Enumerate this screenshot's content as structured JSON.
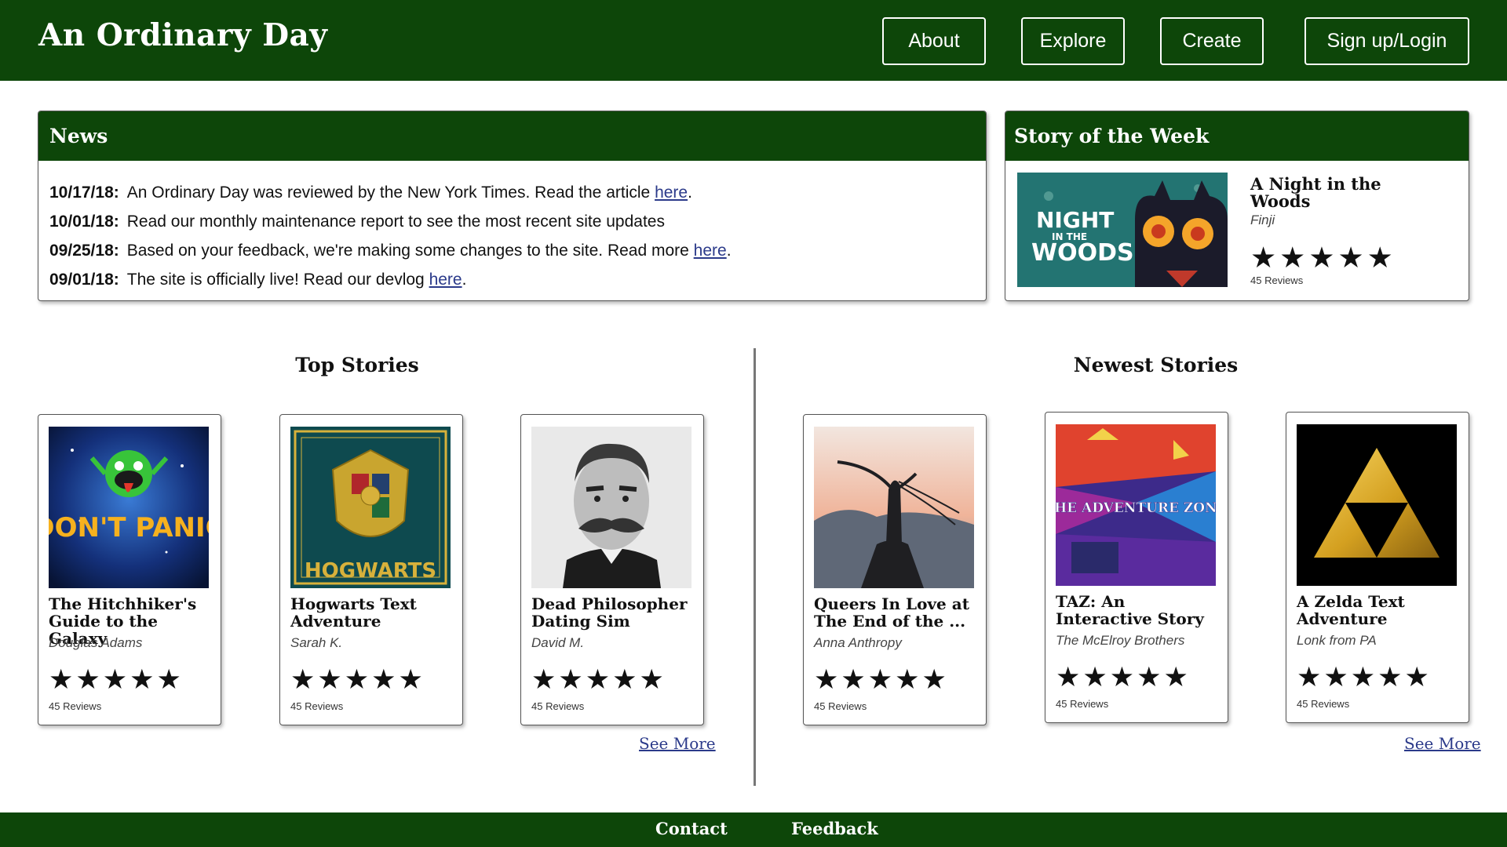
{
  "header": {
    "title": "An Ordinary Day",
    "nav": [
      "About",
      "Explore",
      "Create",
      "Sign up/Login"
    ]
  },
  "news": {
    "heading": "News",
    "items": [
      {
        "date": "10/17/18:",
        "text": "An Ordinary Day was reviewed by the New York Times. Read the article ",
        "link": "here",
        "after": "."
      },
      {
        "date": "10/01/18:",
        "text": "Read our monthly maintenance report to see the most recent site updates",
        "link": "",
        "after": ""
      },
      {
        "date": "09/25/18:",
        "text": "Based on your feedback, we're making some changes to the site. Read more ",
        "link": "here",
        "after": "."
      },
      {
        "date": "09/01/18:",
        "text": "The site is officially live! Read our devlog ",
        "link": "here",
        "after": "."
      }
    ]
  },
  "story_of_week": {
    "heading": "Story of the Week",
    "title": "A Night in the Woods",
    "author": "Finji",
    "rating": 5,
    "stars": "★★★★★",
    "reviews": "45 Reviews",
    "cover_text_1": "NIGHT",
    "cover_text_2": "IN THE",
    "cover_text_3": "WOODS"
  },
  "top_stories": {
    "heading": "Top Stories",
    "see_more": "See More",
    "items": [
      {
        "title": "The Hitchhiker's Guide to the Galaxy",
        "author": "Douglas Adams",
        "rating": 5,
        "stars": "★★★★★",
        "reviews": "45 Reviews",
        "cover_text": "DON'T PANIC"
      },
      {
        "title": "Hogwarts Text Adventure",
        "author": "Sarah K.",
        "rating": 5,
        "stars": "★★★★★",
        "reviews": "45 Reviews",
        "cover_text": "HOGWARTS"
      },
      {
        "title": "Dead Philosopher Dating Sim",
        "author": "David M.",
        "rating": 5,
        "stars": "★★★★★",
        "reviews": "45 Reviews",
        "cover_text": ""
      }
    ]
  },
  "newest_stories": {
    "heading": "Newest Stories",
    "see_more": "See More",
    "items": [
      {
        "title": "Queers In Love at The End of the ...",
        "author": "Anna Anthropy",
        "rating": 5,
        "stars": "★★★★★",
        "reviews": "45 Reviews",
        "cover_text": ""
      },
      {
        "title": "TAZ: An Interactive Story",
        "author": "The McElroy Brothers",
        "rating": 5,
        "stars": "★★★★★",
        "reviews": "45 Reviews",
        "cover_text": "THE ADVENTURE ZONE"
      },
      {
        "title": "A Zelda Text Adventure",
        "author": "Lonk from PA",
        "rating": 5,
        "stars": "★★★★★",
        "reviews": "45 Reviews",
        "cover_text": ""
      }
    ]
  },
  "footer": {
    "links": [
      "Contact",
      "Feedback"
    ]
  },
  "colors": {
    "brand_green": "#0d4609",
    "link": "#2b3a8a"
  }
}
